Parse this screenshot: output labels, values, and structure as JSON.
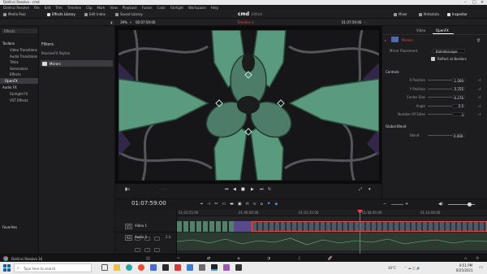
{
  "titlebar": {
    "title": "DaVinci Resolve - cmd"
  },
  "menubar": {
    "items": [
      "DaVinci Resolve",
      "File",
      "Edit",
      "Trim",
      "Timeline",
      "Clip",
      "Mark",
      "View",
      "Playback",
      "Fusion",
      "Color",
      "Fairlight",
      "Workspace",
      "Help"
    ]
  },
  "toolbar": {
    "media_pool": "Media Pool",
    "effects_library": "Effects Library",
    "edit_index": "Edit Index",
    "sound_library": "Sound Library",
    "project_name": "cmd",
    "project_status": "Edited",
    "mixer": "Mixer",
    "metadata": "Metadata",
    "inspector": "Inspector"
  },
  "viewerbar": {
    "zoom": "39%",
    "source_tc": "00:07:59:00",
    "timeline_name": "Timeline 1",
    "record_tc": "01:07:59:00"
  },
  "leftpanel": {
    "search_label": "Effects",
    "toolbox": "Toolbox",
    "items": [
      "Video Transitions",
      "Audio Transitions",
      "Titles",
      "Generators",
      "Effects"
    ],
    "openfx": "OpenFX",
    "audiofx": "Audio FX",
    "audio_items": [
      "Fairlight FX",
      "VST Effects"
    ],
    "favorites": "Favorites"
  },
  "filters": {
    "header": "Filters",
    "subheader": "ResolveFX Stylize",
    "item": "Mirrors"
  },
  "inspector": {
    "tabs": [
      "Video",
      "OpenFX"
    ],
    "effect_name": "Mirrors",
    "mirror_placement_label": "Mirror Placement",
    "mirror_placement_value": "Kaleidoscope",
    "reflect_label": "Reflect at Borders",
    "controls_header": "Controls",
    "rows": [
      {
        "label": "X Position",
        "value": "1.000"
      },
      {
        "label": "Y Position",
        "value": "0.256"
      },
      {
        "label": "Center Size",
        "value": "0.276"
      },
      {
        "label": "Angle",
        "value": "0.0"
      },
      {
        "label": "Number Of Sides",
        "value": "3"
      }
    ],
    "global_blend_header": "Global Blend",
    "blend_label": "Blend",
    "blend_value": "0.000"
  },
  "transport": {
    "timecode": "01:07:59:00"
  },
  "timeline": {
    "ruler_ticks": [
      "01:03:25:00",
      "01:06:00:00",
      "01:03:35:00",
      "01:08:40:00",
      "01:14:00:00"
    ],
    "v1_label": "V1",
    "v1_name": "Video 1",
    "a1_label": "A1",
    "a1_name": "Audio 1",
    "a1_level": "2.0"
  },
  "pagebar": {
    "app": "DaVinci Resolve 16"
  },
  "taskbar": {
    "search": "Type here to search",
    "weather": "30°C",
    "time": "8:51 PM",
    "date": "8/25/2021"
  },
  "colors": {
    "accent": "#e64b4b",
    "green": "#3fd27a",
    "teal": "#5a9a7e",
    "selected": "#3a3a3f"
  }
}
